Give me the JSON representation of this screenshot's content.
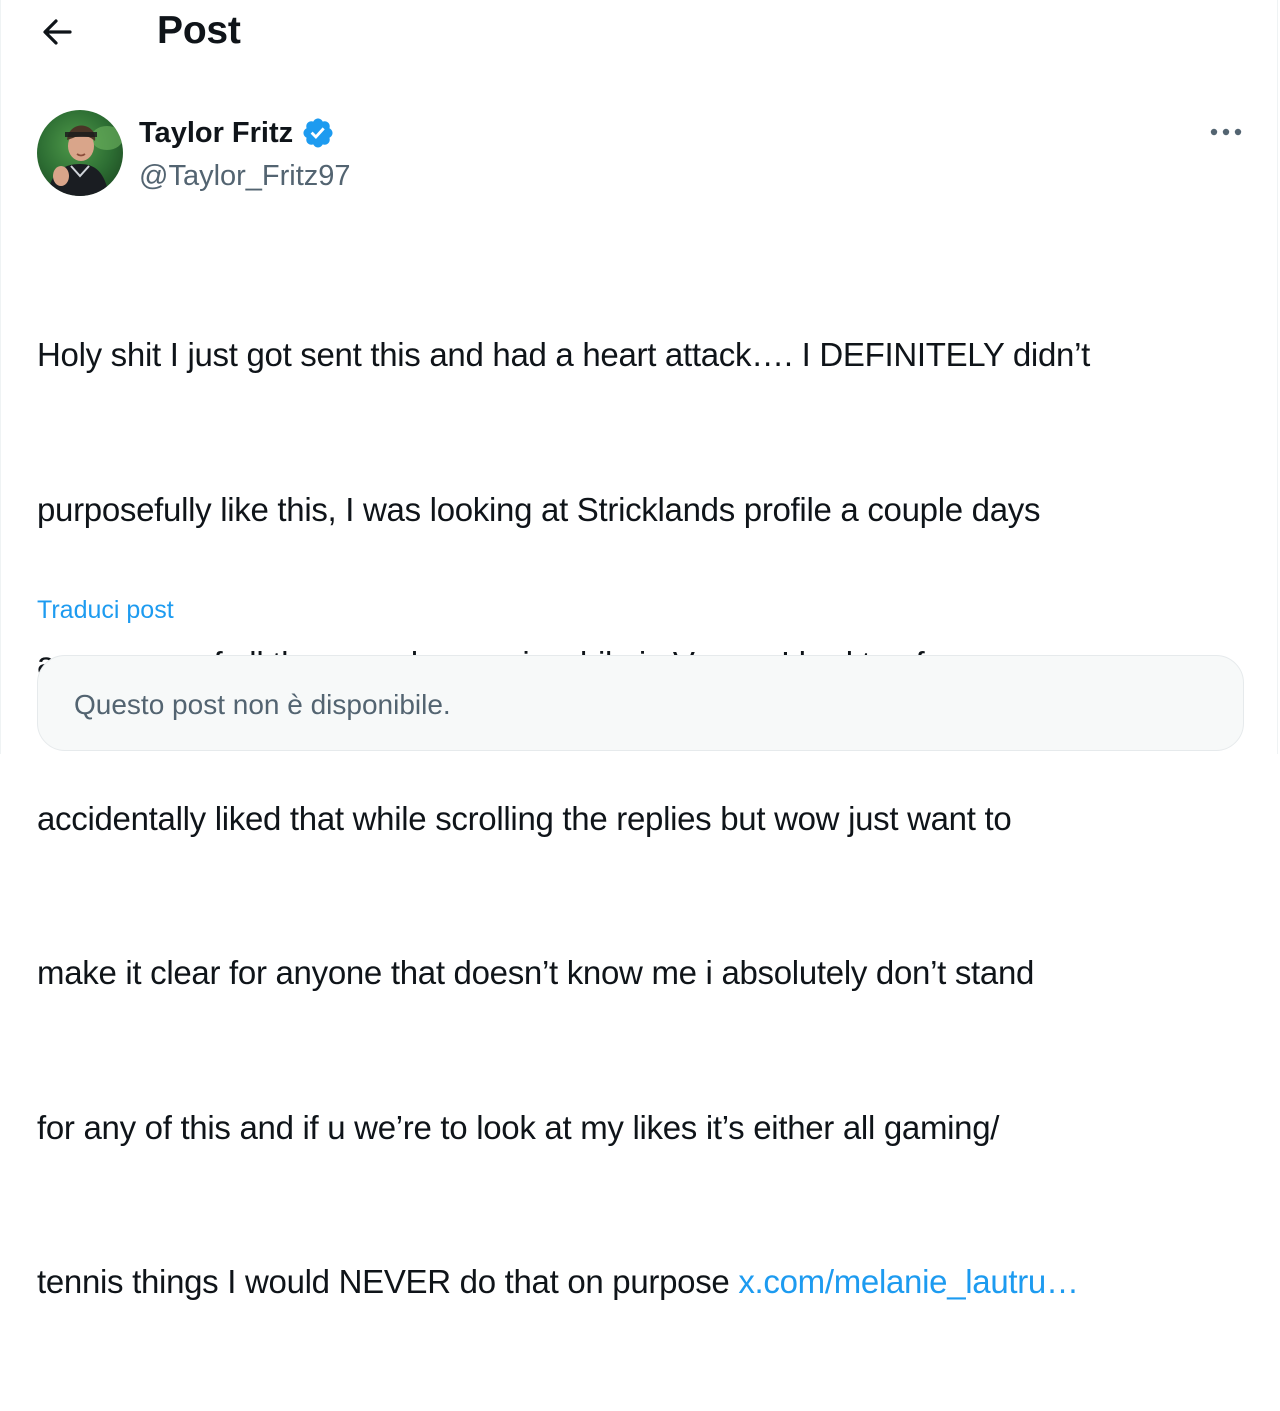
{
  "header": {
    "back_icon": "arrow-left-icon",
    "title": "Post"
  },
  "author": {
    "name": "Taylor Fritz",
    "handle": "@Taylor_Fritz97",
    "verified_icon": "verified-badge-icon",
    "verified_color": "#1d9bf0"
  },
  "post": {
    "lines": [
      "Holy shit I just got sent this and had a heart attack…. I DEFINITELY didn’t",
      "purposefully like this, I was looking at Stricklands profile a couple days",
      "ago cause of all the news he was in while in Vegas. I had to of",
      "accidentally liked that while scrolling the replies but wow just want to",
      "make it clear for anyone that doesn’t know me i absolutely don’t stand",
      "for any of this and if u we’re to look at my likes it’s either all gaming/",
      "tennis things I would NEVER do that on purpose "
    ],
    "link": "x.com/melanie_lautru…",
    "translate_label": "Traduci post",
    "more_icon": "more-horizontal-icon"
  },
  "quoted": {
    "text": "Questo post non è disponibile."
  },
  "colors": {
    "link": "#1d9bf0",
    "secondary_text": "#536471",
    "primary_text": "#0f1419"
  }
}
